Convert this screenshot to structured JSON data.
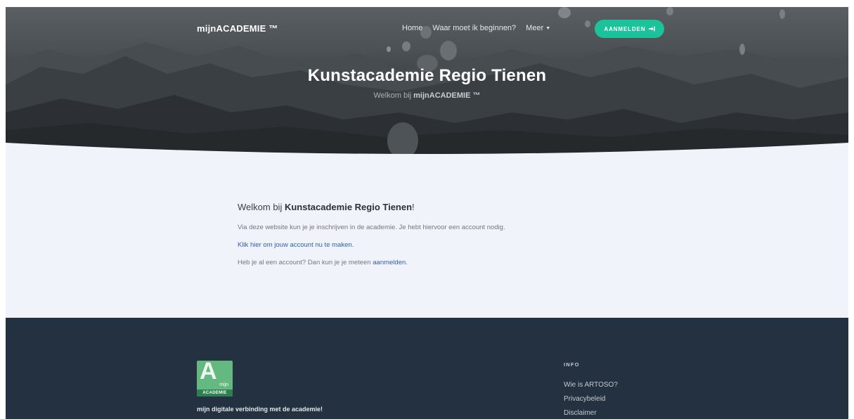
{
  "nav": {
    "brand": "mijnACADEMIE ™",
    "links": [
      "Home",
      "Waar moet ik beginnen?",
      "Meer"
    ],
    "login_button": "AANMELDEN"
  },
  "hero": {
    "title": "Kunstacademie Regio Tienen",
    "subtitle_prefix": "Welkom bij ",
    "subtitle_brand": "mijnACADEMIE ™"
  },
  "content": {
    "welcome_prefix": "Welkom bij ",
    "welcome_org": "Kunstacademie Regio Tienen",
    "welcome_suffix": "!",
    "intro": "Via deze website kun je je inschrijven in de academie. Je hebt hiervoor een account nodig.",
    "create_account_link": "Klik hier om jouw account nu te maken.",
    "have_account_prefix": "Heb je al een account? Dan kun je je meteen ",
    "login_link": "aanmelden",
    "have_account_suffix": "."
  },
  "footer": {
    "logo_letter": "A",
    "logo_mijn": "mijn",
    "logo_academie": "ACADEMIE",
    "tagline": "mijn digitale verbinding met de academie!",
    "info_title": "INFO",
    "info_links": [
      "Wie is ARTOSO?",
      "Privacybeleid",
      "Disclaimer"
    ]
  },
  "colors": {
    "accent": "#1bc39a",
    "link": "#2d5fae",
    "footer_bg": "#243140",
    "content_bg": "#f0f3fa"
  }
}
